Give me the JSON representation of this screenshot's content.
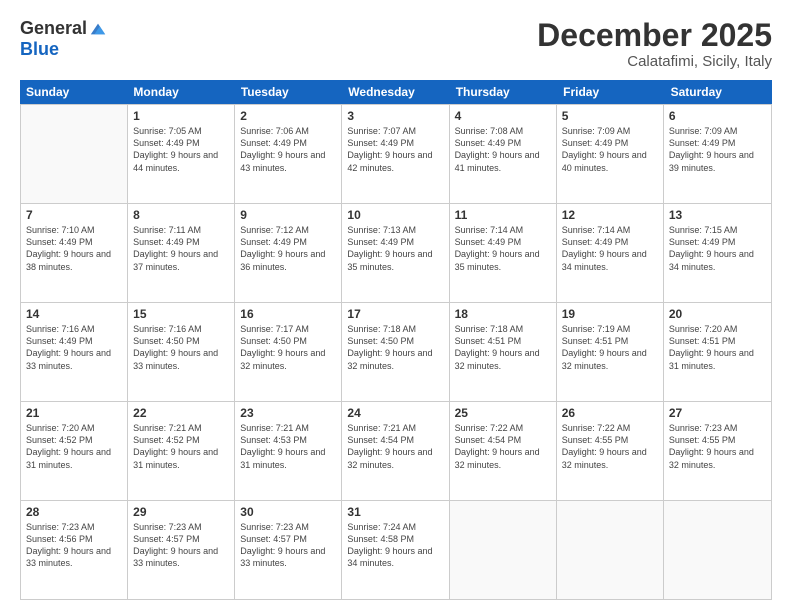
{
  "logo": {
    "general": "General",
    "blue": "Blue"
  },
  "title": "December 2025",
  "subtitle": "Calatafimi, Sicily, Italy",
  "header_days": [
    "Sunday",
    "Monday",
    "Tuesday",
    "Wednesday",
    "Thursday",
    "Friday",
    "Saturday"
  ],
  "weeks": [
    [
      {
        "day": "",
        "sunrise": "",
        "sunset": "",
        "daylight": "",
        "empty": true
      },
      {
        "day": "1",
        "sunrise": "Sunrise: 7:05 AM",
        "sunset": "Sunset: 4:49 PM",
        "daylight": "Daylight: 9 hours and 44 minutes.",
        "empty": false
      },
      {
        "day": "2",
        "sunrise": "Sunrise: 7:06 AM",
        "sunset": "Sunset: 4:49 PM",
        "daylight": "Daylight: 9 hours and 43 minutes.",
        "empty": false
      },
      {
        "day": "3",
        "sunrise": "Sunrise: 7:07 AM",
        "sunset": "Sunset: 4:49 PM",
        "daylight": "Daylight: 9 hours and 42 minutes.",
        "empty": false
      },
      {
        "day": "4",
        "sunrise": "Sunrise: 7:08 AM",
        "sunset": "Sunset: 4:49 PM",
        "daylight": "Daylight: 9 hours and 41 minutes.",
        "empty": false
      },
      {
        "day": "5",
        "sunrise": "Sunrise: 7:09 AM",
        "sunset": "Sunset: 4:49 PM",
        "daylight": "Daylight: 9 hours and 40 minutes.",
        "empty": false
      },
      {
        "day": "6",
        "sunrise": "Sunrise: 7:09 AM",
        "sunset": "Sunset: 4:49 PM",
        "daylight": "Daylight: 9 hours and 39 minutes.",
        "empty": false
      }
    ],
    [
      {
        "day": "7",
        "sunrise": "Sunrise: 7:10 AM",
        "sunset": "Sunset: 4:49 PM",
        "daylight": "Daylight: 9 hours and 38 minutes.",
        "empty": false
      },
      {
        "day": "8",
        "sunrise": "Sunrise: 7:11 AM",
        "sunset": "Sunset: 4:49 PM",
        "daylight": "Daylight: 9 hours and 37 minutes.",
        "empty": false
      },
      {
        "day": "9",
        "sunrise": "Sunrise: 7:12 AM",
        "sunset": "Sunset: 4:49 PM",
        "daylight": "Daylight: 9 hours and 36 minutes.",
        "empty": false
      },
      {
        "day": "10",
        "sunrise": "Sunrise: 7:13 AM",
        "sunset": "Sunset: 4:49 PM",
        "daylight": "Daylight: 9 hours and 35 minutes.",
        "empty": false
      },
      {
        "day": "11",
        "sunrise": "Sunrise: 7:14 AM",
        "sunset": "Sunset: 4:49 PM",
        "daylight": "Daylight: 9 hours and 35 minutes.",
        "empty": false
      },
      {
        "day": "12",
        "sunrise": "Sunrise: 7:14 AM",
        "sunset": "Sunset: 4:49 PM",
        "daylight": "Daylight: 9 hours and 34 minutes.",
        "empty": false
      },
      {
        "day": "13",
        "sunrise": "Sunrise: 7:15 AM",
        "sunset": "Sunset: 4:49 PM",
        "daylight": "Daylight: 9 hours and 34 minutes.",
        "empty": false
      }
    ],
    [
      {
        "day": "14",
        "sunrise": "Sunrise: 7:16 AM",
        "sunset": "Sunset: 4:49 PM",
        "daylight": "Daylight: 9 hours and 33 minutes.",
        "empty": false
      },
      {
        "day": "15",
        "sunrise": "Sunrise: 7:16 AM",
        "sunset": "Sunset: 4:50 PM",
        "daylight": "Daylight: 9 hours and 33 minutes.",
        "empty": false
      },
      {
        "day": "16",
        "sunrise": "Sunrise: 7:17 AM",
        "sunset": "Sunset: 4:50 PM",
        "daylight": "Daylight: 9 hours and 32 minutes.",
        "empty": false
      },
      {
        "day": "17",
        "sunrise": "Sunrise: 7:18 AM",
        "sunset": "Sunset: 4:50 PM",
        "daylight": "Daylight: 9 hours and 32 minutes.",
        "empty": false
      },
      {
        "day": "18",
        "sunrise": "Sunrise: 7:18 AM",
        "sunset": "Sunset: 4:51 PM",
        "daylight": "Daylight: 9 hours and 32 minutes.",
        "empty": false
      },
      {
        "day": "19",
        "sunrise": "Sunrise: 7:19 AM",
        "sunset": "Sunset: 4:51 PM",
        "daylight": "Daylight: 9 hours and 32 minutes.",
        "empty": false
      },
      {
        "day": "20",
        "sunrise": "Sunrise: 7:20 AM",
        "sunset": "Sunset: 4:51 PM",
        "daylight": "Daylight: 9 hours and 31 minutes.",
        "empty": false
      }
    ],
    [
      {
        "day": "21",
        "sunrise": "Sunrise: 7:20 AM",
        "sunset": "Sunset: 4:52 PM",
        "daylight": "Daylight: 9 hours and 31 minutes.",
        "empty": false
      },
      {
        "day": "22",
        "sunrise": "Sunrise: 7:21 AM",
        "sunset": "Sunset: 4:52 PM",
        "daylight": "Daylight: 9 hours and 31 minutes.",
        "empty": false
      },
      {
        "day": "23",
        "sunrise": "Sunrise: 7:21 AM",
        "sunset": "Sunset: 4:53 PM",
        "daylight": "Daylight: 9 hours and 31 minutes.",
        "empty": false
      },
      {
        "day": "24",
        "sunrise": "Sunrise: 7:21 AM",
        "sunset": "Sunset: 4:54 PM",
        "daylight": "Daylight: 9 hours and 32 minutes.",
        "empty": false
      },
      {
        "day": "25",
        "sunrise": "Sunrise: 7:22 AM",
        "sunset": "Sunset: 4:54 PM",
        "daylight": "Daylight: 9 hours and 32 minutes.",
        "empty": false
      },
      {
        "day": "26",
        "sunrise": "Sunrise: 7:22 AM",
        "sunset": "Sunset: 4:55 PM",
        "daylight": "Daylight: 9 hours and 32 minutes.",
        "empty": false
      },
      {
        "day": "27",
        "sunrise": "Sunrise: 7:23 AM",
        "sunset": "Sunset: 4:55 PM",
        "daylight": "Daylight: 9 hours and 32 minutes.",
        "empty": false
      }
    ],
    [
      {
        "day": "28",
        "sunrise": "Sunrise: 7:23 AM",
        "sunset": "Sunset: 4:56 PM",
        "daylight": "Daylight: 9 hours and 33 minutes.",
        "empty": false
      },
      {
        "day": "29",
        "sunrise": "Sunrise: 7:23 AM",
        "sunset": "Sunset: 4:57 PM",
        "daylight": "Daylight: 9 hours and 33 minutes.",
        "empty": false
      },
      {
        "day": "30",
        "sunrise": "Sunrise: 7:23 AM",
        "sunset": "Sunset: 4:57 PM",
        "daylight": "Daylight: 9 hours and 33 minutes.",
        "empty": false
      },
      {
        "day": "31",
        "sunrise": "Sunrise: 7:24 AM",
        "sunset": "Sunset: 4:58 PM",
        "daylight": "Daylight: 9 hours and 34 minutes.",
        "empty": false
      },
      {
        "day": "",
        "sunrise": "",
        "sunset": "",
        "daylight": "",
        "empty": true
      },
      {
        "day": "",
        "sunrise": "",
        "sunset": "",
        "daylight": "",
        "empty": true
      },
      {
        "day": "",
        "sunrise": "",
        "sunset": "",
        "daylight": "",
        "empty": true
      }
    ]
  ]
}
